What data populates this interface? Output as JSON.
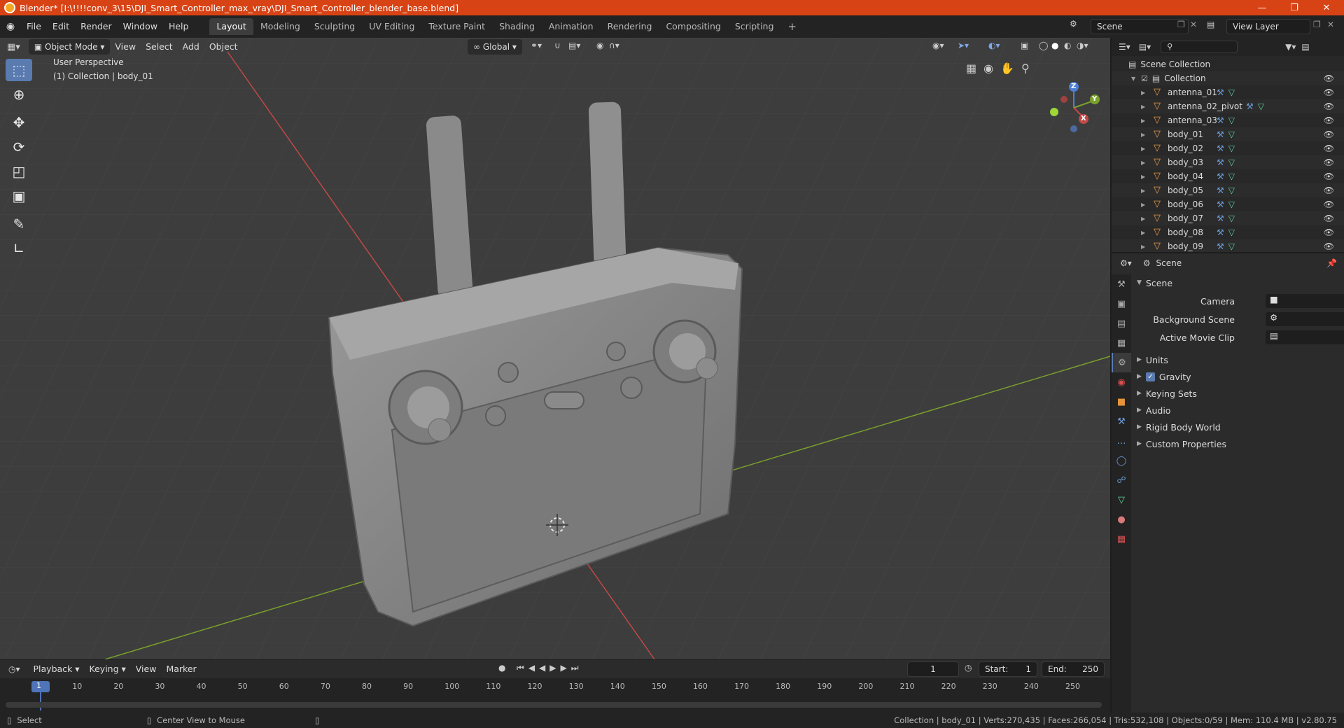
{
  "title_bar": {
    "text": "Blender* [I:\\!!!!conv_3\\15\\DJI_Smart_Controller_max_vray\\DJI_Smart_Controller_blender_base.blend]"
  },
  "menu": {
    "items": [
      "File",
      "Edit",
      "Render",
      "Window",
      "Help"
    ]
  },
  "workspaces": [
    "Layout",
    "Modeling",
    "Sculpting",
    "UV Editing",
    "Texture Paint",
    "Shading",
    "Animation",
    "Rendering",
    "Compositing",
    "Scripting"
  ],
  "workspace_add": "+",
  "scene_field": "Scene",
  "view_layer_field": "View Layer",
  "viewport_header": {
    "mode": "Object Mode",
    "menus": [
      "View",
      "Select",
      "Add",
      "Object"
    ],
    "orientation": "Global"
  },
  "viewport_overlay": {
    "perspective": "User Perspective",
    "collection_info": "(1) Collection | body_01"
  },
  "gizmo": {
    "z": "Z",
    "y": "Y",
    "x": "X"
  },
  "outliner": {
    "scene_collection": "Scene Collection",
    "collection": "Collection",
    "objects": [
      "antenna_01",
      "antenna_02_pivot",
      "antenna_03",
      "body_01",
      "body_02",
      "body_03",
      "body_04",
      "body_05",
      "body_06",
      "body_07",
      "body_08",
      "body_09"
    ]
  },
  "properties": {
    "header": "Scene",
    "section": "Scene",
    "camera_label": "Camera",
    "background_scene_label": "Background Scene",
    "active_movie_clip_label": "Active Movie Clip",
    "panels": [
      "Units",
      "Gravity",
      "Keying Sets",
      "Audio",
      "Rigid Body World",
      "Custom Properties"
    ]
  },
  "timeline": {
    "menus": [
      "Playback",
      "Keying",
      "View",
      "Marker"
    ],
    "current_frame": "1",
    "start_label": "Start:",
    "start_value": "1",
    "end_label": "End:",
    "end_value": "250",
    "ruler": [
      "1",
      "10",
      "20",
      "30",
      "40",
      "50",
      "60",
      "70",
      "80",
      "90",
      "100",
      "110",
      "120",
      "130",
      "140",
      "150",
      "160",
      "170",
      "180",
      "190",
      "200",
      "210",
      "220",
      "230",
      "240",
      "250"
    ]
  },
  "status_bar": {
    "left": "Select",
    "middle": "Center View to Mouse",
    "right": "Collection | body_01 | Verts:270,435 | Faces:266,054 | Tris:532,108 | Objects:0/59 | Mem: 110.4 MB | v2.80.75"
  }
}
